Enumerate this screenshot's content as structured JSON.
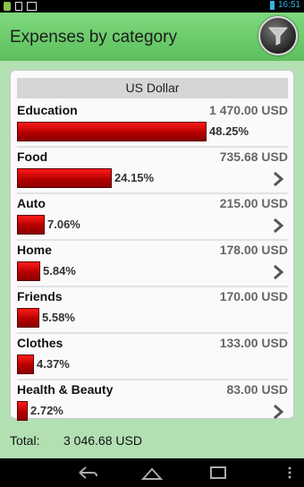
{
  "status_bar": {
    "time": "16:51"
  },
  "header": {
    "title": "Expenses by category"
  },
  "card": {
    "currency": "US Dollar",
    "rows": [
      {
        "name": "Education",
        "amount": "1 470.00 USD",
        "percent": "48.25%",
        "share": 48.25,
        "has_chevron": false
      },
      {
        "name": "Food",
        "amount": "735.68 USD",
        "percent": "24.15%",
        "share": 24.15,
        "has_chevron": true
      },
      {
        "name": "Auto",
        "amount": "215.00 USD",
        "percent": "7.06%",
        "share": 7.06,
        "has_chevron": true
      },
      {
        "name": "Home",
        "amount": "178.00 USD",
        "percent": "5.84%",
        "share": 5.84,
        "has_chevron": true
      },
      {
        "name": "Friends",
        "amount": "170.00 USD",
        "percent": "5.58%",
        "share": 5.58,
        "has_chevron": false
      },
      {
        "name": "Clothes",
        "amount": "133.00 USD",
        "percent": "4.37%",
        "share": 4.37,
        "has_chevron": false
      },
      {
        "name": "Health & Beauty",
        "amount": "83.00 USD",
        "percent": "2.72%",
        "share": 2.72,
        "has_chevron": true
      }
    ]
  },
  "footer": {
    "total_label": "Total:",
    "total_value": "3 046.68 USD"
  },
  "icons": {
    "filter": "filter-icon",
    "chevron": "chevron-right-icon",
    "nav_back": "back-icon",
    "nav_home": "home-icon",
    "nav_recents": "recents-icon",
    "nav_menu": "overflow-menu-icon"
  },
  "colors": {
    "header": "#5cc05c",
    "bar": "#cc0000",
    "background": "#b3e0b3"
  }
}
